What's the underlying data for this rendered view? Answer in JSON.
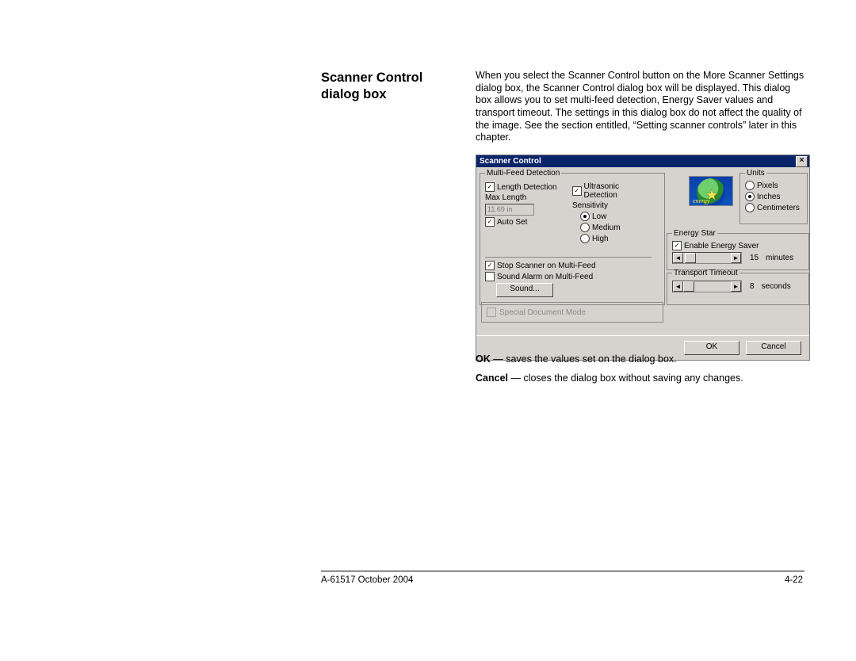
{
  "heading": "Scanner Control dialog box",
  "intro": "When you select the Scanner Control button on the More Scanner Settings dialog box, the Scanner Control dialog box will be displayed. This dialog box allows you to set multi-feed detection, Energy Saver values and transport timeout. The settings in this dialog box do not affect the quality of the image. See the section entitled, “Setting scanner controls” later in this chapter.",
  "dialog": {
    "title": "Scanner Control",
    "close_x": "×",
    "multiFeed": {
      "legend": "Multi-Feed Detection",
      "lengthDetection": "Length Detection",
      "maxLength": "Max Length",
      "maxLengthValue": "11.69 in",
      "autoSet": "Auto Set",
      "ultrasonic": "Ultrasonic Detection",
      "sensitivity": "Sensitivity",
      "low": "Low",
      "medium": "Medium",
      "high": "High",
      "stopScanner": "Stop Scanner on Multi-Feed",
      "soundAlarm": "Sound Alarm on Multi-Feed",
      "soundBtn": "Sound..."
    },
    "specialDoc": "Special Document Mode",
    "units": {
      "legend": "Units",
      "pixels": "Pixels",
      "inches": "Inches",
      "centimeters": "Centimeters"
    },
    "energyStar": {
      "legend": "Energy Star",
      "enable": "Enable Energy Saver",
      "value": "15",
      "unit": "minutes"
    },
    "transport": {
      "legend": "Transport Timeout",
      "value": "8",
      "unit": "seconds"
    },
    "logoText": "energy",
    "ok": "OK",
    "cancel": "Cancel"
  },
  "below": {
    "ok_bold": "OK",
    "ok_rest": " — saves the values set on the dialog box.",
    "cancel_bold": "Cancel",
    "cancel_rest": " — closes the dialog box without saving any changes."
  },
  "footer": {
    "left": "A-61517 October 2004",
    "right": "4-22"
  }
}
